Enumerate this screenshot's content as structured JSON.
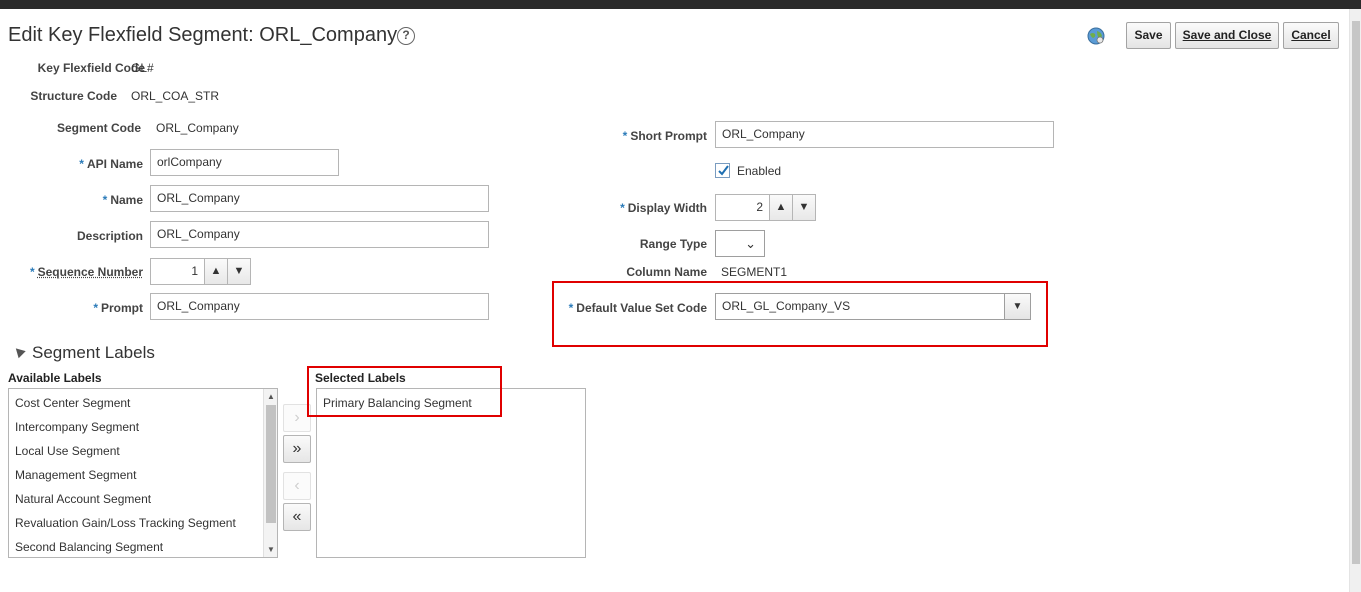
{
  "page": {
    "title": "Edit Key Flexfield Segment: ORL_Company",
    "help_glyph": "?"
  },
  "toolbar": {
    "save_label": "Save",
    "save_close_label": "Save and Close",
    "cancel_label": "Cancel"
  },
  "header_fields": {
    "key_flexfield_code": {
      "label": "Key Flexfield Code",
      "value": "GL#"
    },
    "structure_code": {
      "label": "Structure Code",
      "value": "ORL_COA_STR"
    }
  },
  "left_form": {
    "segment_code": {
      "label": "Segment Code",
      "value": "ORL_Company"
    },
    "api_name": {
      "label": "API Name",
      "value": "orlCompany"
    },
    "name": {
      "label": "Name",
      "value": "ORL_Company"
    },
    "description": {
      "label": "Description",
      "value": "ORL_Company"
    },
    "sequence_number": {
      "label": "Sequence Number",
      "value": "1"
    },
    "prompt": {
      "label": "Prompt",
      "value": "ORL_Company"
    }
  },
  "right_form": {
    "short_prompt": {
      "label": "Short Prompt",
      "value": "ORL_Company"
    },
    "enabled": {
      "label": "Enabled",
      "checked": true
    },
    "display_width": {
      "label": "Display Width",
      "value": "2"
    },
    "range_type": {
      "label": "Range Type",
      "value": ""
    },
    "column_name": {
      "label": "Column Name",
      "value": "SEGMENT1"
    },
    "default_value_set_code": {
      "label": "Default Value Set Code",
      "value": "ORL_GL_Company_VS"
    }
  },
  "required_marker": "*",
  "segment_labels": {
    "section_title": "Segment Labels",
    "available_header": "Available Labels",
    "selected_header": "Selected Labels",
    "available": [
      "Cost Center Segment",
      "Intercompany Segment",
      "Local Use Segment",
      "Management Segment",
      "Natural Account Segment",
      "Revaluation Gain/Loss Tracking Segment",
      "Second Balancing Segment"
    ],
    "selected": [
      "Primary Balancing Segment"
    ],
    "shuttle": {
      "move": "›",
      "move_all": "»",
      "remove": "‹",
      "remove_all": "«"
    }
  },
  "colors": {
    "required": "#2b7bb9",
    "highlight": "#e00000",
    "topbar": "#2b2b2b"
  }
}
